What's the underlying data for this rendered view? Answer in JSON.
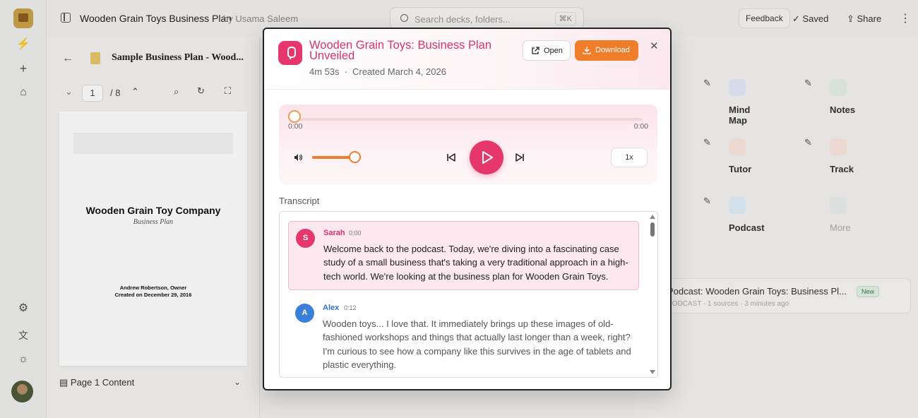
{
  "app": {
    "doc_title": "Wooden Grain Toys Business Plan",
    "byline": "by Usama Saleem",
    "search_placeholder": "Search decks, folders...",
    "search_shortcut": "⌘K",
    "feedback_label": "Feedback",
    "saved_label": "Saved",
    "share_label": "Share"
  },
  "doc_pane": {
    "doc_name": "Sample Business Plan - Wood...",
    "page_current": "1",
    "page_total": "/ 8",
    "page_company": "Wooden Grain Toy Company",
    "page_subtitle": "Business Plan",
    "page_owner": "Andrew Robertson, Owner",
    "page_created": "Created on December 29, 2016",
    "page_content_label": "Page 1 Content"
  },
  "studio": {
    "tools": [
      {
        "label": "Mind Map",
        "color": "#3f55c9"
      },
      {
        "label": "Notes",
        "color": "#4a9a4a"
      },
      {
        "label": "Tutor",
        "color": "#d9542e"
      },
      {
        "label": "Track",
        "color": "#d9542e"
      },
      {
        "label": "Podcast",
        "color": "#2f7fc4"
      },
      {
        "label": "More",
        "color": "#9aa0a6"
      }
    ],
    "recent_title": "Podcast: Wooden Grain Toys: Business Pl...",
    "recent_meta": "PODCAST · 1 sources · 3 minutes ago",
    "recent_badge": "New"
  },
  "modal": {
    "title": "Wooden Grain Toys: Business Plan Unveiled",
    "duration": "4m 53s",
    "created": "Created March 4, 2026",
    "open_label": "Open",
    "download_label": "Download",
    "player": {
      "current_time": "0:00",
      "total_time": "0:00",
      "progress": 0,
      "volume": 1.0,
      "speed": "1x"
    },
    "transcript_label": "Transcript",
    "transcript": [
      {
        "speaker": "Sarah",
        "initial": "S",
        "time": "0:00",
        "color": "#e5376b",
        "text": "Welcome back to the podcast. Today, we're diving into a fascinating case study of a small business that's taking a very traditional approach in a high-tech world. We're looking at the business plan for Wooden Grain Toys."
      },
      {
        "speaker": "Alex",
        "initial": "A",
        "time": "0:12",
        "color": "#3a7fd9",
        "text": "Wooden toys... I love that. It immediately brings up these images of old-fashioned workshops and things that actually last longer than a week, right? I'm curious to see how a company like this survives in the age of tablets and plastic everything."
      }
    ]
  }
}
